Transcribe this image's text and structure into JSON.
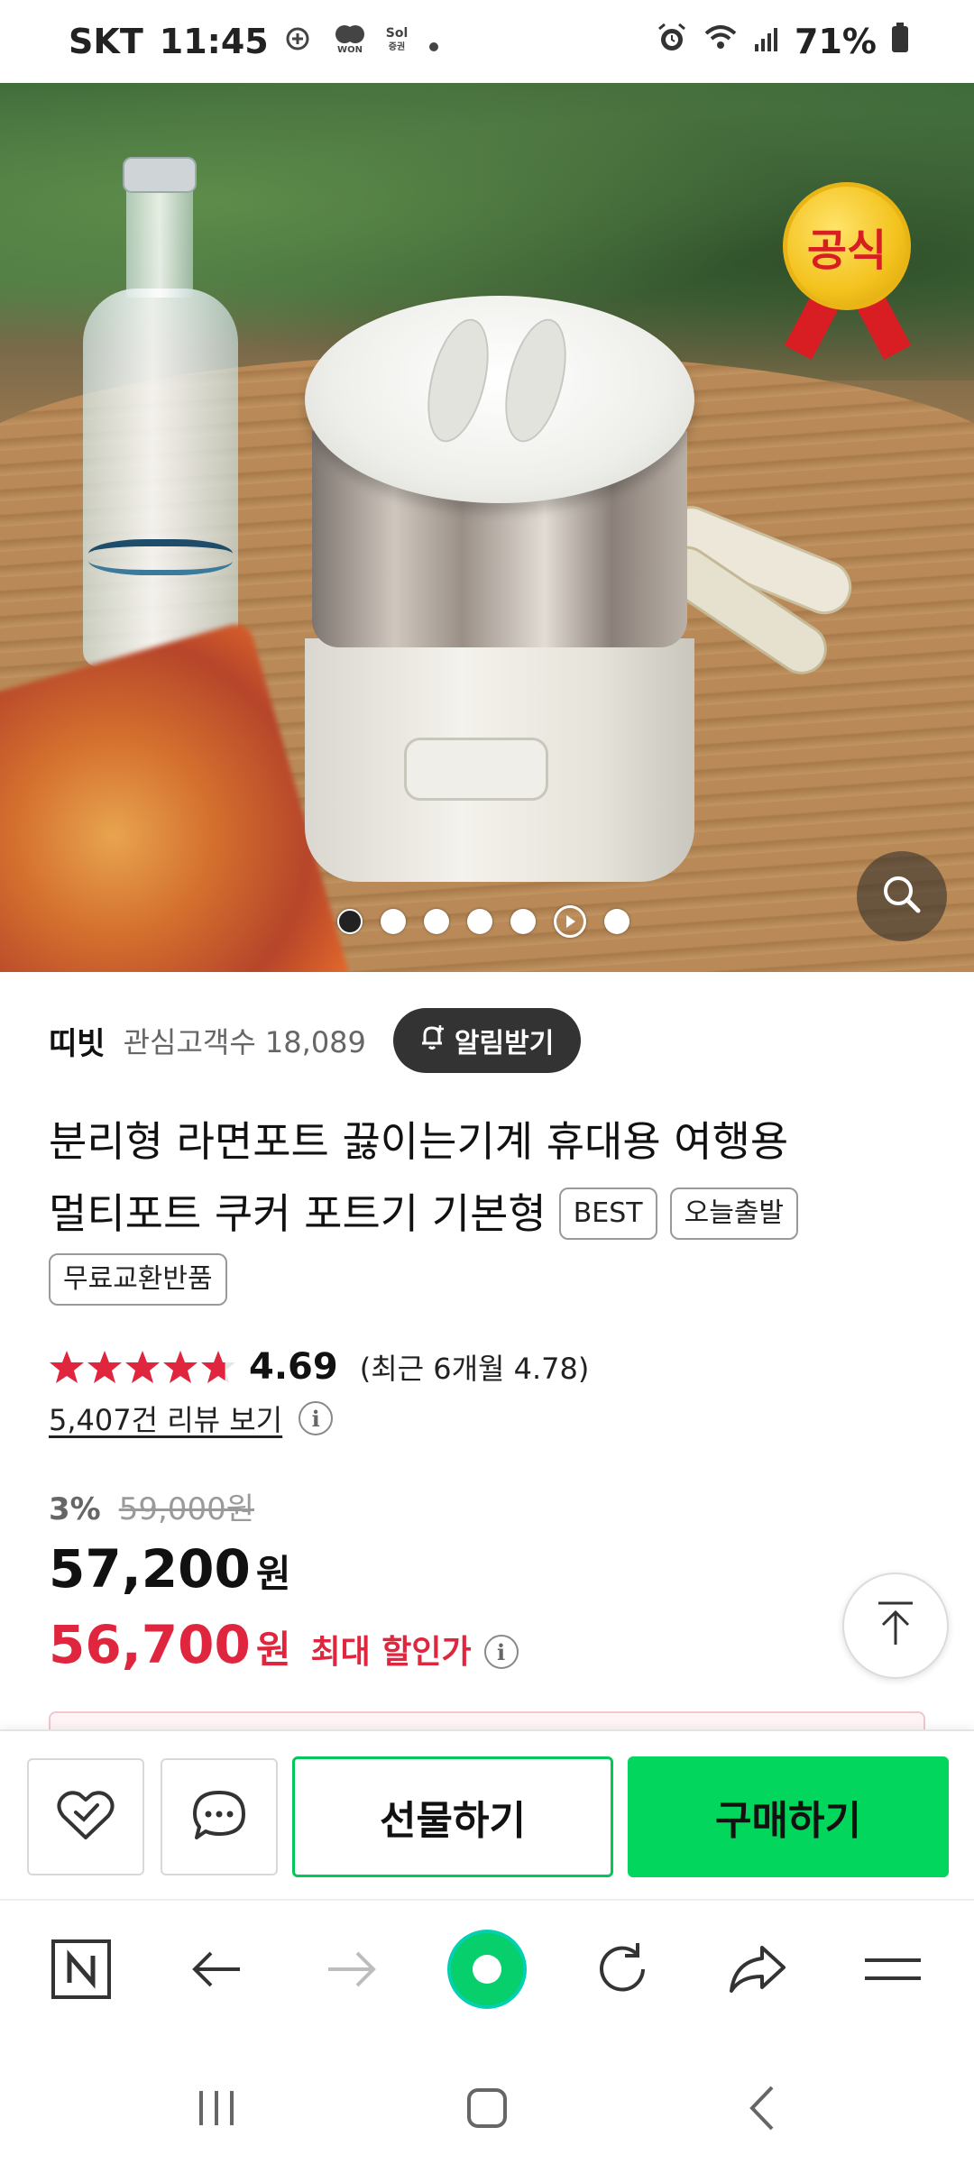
{
  "status_bar": {
    "carrier": "SKT",
    "time": "11:45",
    "battery": "71%",
    "notification_icons": [
      "running-icon",
      "won-icon",
      "sol-securities-icon",
      "dot-icon"
    ],
    "system_icons": [
      "alarm-icon",
      "wifi-icon",
      "signal-icon",
      "battery-icon"
    ]
  },
  "hero": {
    "badge_text": "공식",
    "image_count": 7,
    "active_index": 0,
    "video_index": 5
  },
  "store": {
    "name": "띠빗",
    "followers": "관심고객수 18,089",
    "notify_label": "알림받기"
  },
  "product": {
    "title_line1": "분리형 라면포트 끓이는기계 휴대용 여행용",
    "title_line2": "멀티포트 쿠커 포트기 기본형",
    "tags": [
      "BEST",
      "오늘출발",
      "무료교환반품"
    ]
  },
  "rating": {
    "score": "4.69",
    "stars_value": 4.69,
    "recent": "(최근 6개월 4.78)",
    "review_link": "5,407건 리뷰 보기"
  },
  "price": {
    "discount": "3%",
    "original": "59,000원",
    "sale": "57,200",
    "max_discount": "56,700",
    "won": "원",
    "max_label": "최대 할인가"
  },
  "actions": {
    "gift": "선물하기",
    "buy": "구매하기"
  },
  "colors": {
    "accent_green": "#03c75a",
    "price_red": "#e0263e",
    "star_red": "#e0263e"
  },
  "browser_toolbar": [
    "naver-home-icon",
    "back-arrow-icon",
    "forward-arrow-icon",
    "green-dot-icon",
    "refresh-icon",
    "share-icon",
    "menu-icon"
  ],
  "system_nav": [
    "recents-icon",
    "home-icon",
    "back-icon"
  ]
}
